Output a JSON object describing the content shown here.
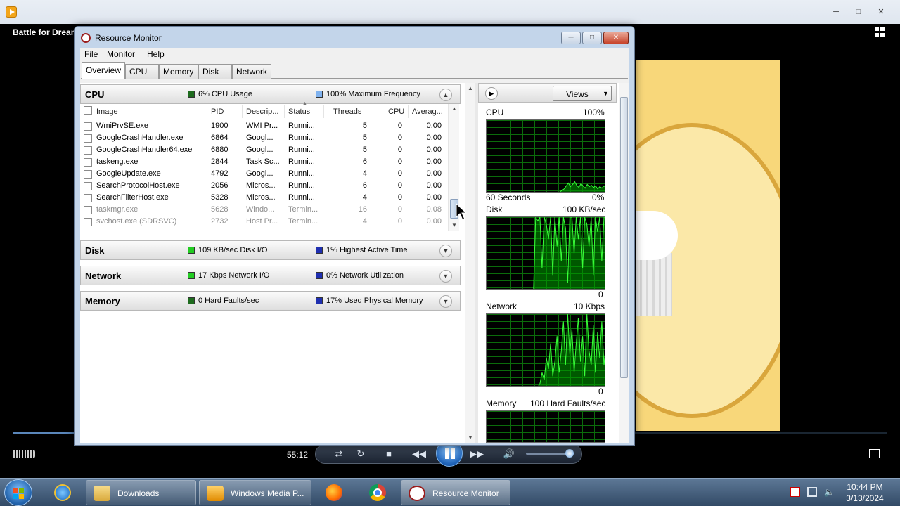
{
  "media_player": {
    "title": "Battle for Dream",
    "time": "55:12",
    "progress_fraction": 0.07,
    "volume_fraction": 0.88,
    "window_controls": [
      "minimize",
      "maximize",
      "close"
    ],
    "icons": [
      "switch-to-library-icon",
      "shuffle-icon",
      "repeat-icon",
      "stop-icon",
      "previous-icon",
      "pause-icon",
      "next-icon",
      "volume-icon",
      "fullscreen-icon",
      "play-speed-gripper-icon"
    ]
  },
  "resource_monitor": {
    "window_title": "Resource Monitor",
    "menu": [
      "File",
      "Monitor",
      "Help"
    ],
    "tabs": [
      "Overview",
      "CPU",
      "Memory",
      "Disk",
      "Network"
    ],
    "active_tab": "Overview",
    "sections": {
      "cpu": {
        "title": "CPU",
        "metric1": "6% CPU Usage",
        "metric1_color": "#1e6b1e",
        "metric2": "100% Maximum Frequency",
        "metric2_color": "#7fb2ef"
      },
      "disk": {
        "title": "Disk",
        "metric1": "109 KB/sec Disk I/O",
        "metric1_color": "#22cc22",
        "metric2": "1% Highest Active Time",
        "metric2_color": "#1f2fb0"
      },
      "network": {
        "title": "Network",
        "metric1": "17 Kbps Network I/O",
        "metric1_color": "#22cc22",
        "metric2": "0% Network Utilization",
        "metric2_color": "#1f2fb0"
      },
      "memory": {
        "title": "Memory",
        "metric1": "0 Hard Faults/sec",
        "metric1_color": "#1e6b1e",
        "metric2": "17% Used Physical Memory",
        "metric2_color": "#1f2fb0"
      }
    },
    "columns": [
      "Image",
      "PID",
      "Descrip...",
      "Status",
      "Threads",
      "CPU",
      "Averag..."
    ],
    "processes": [
      {
        "image": "WmiPrvSE.exe",
        "pid": "1900",
        "desc": "WMI Pr...",
        "status": "Runni...",
        "threads": "5",
        "cpu": "0",
        "avg": "0.00",
        "terminated": false
      },
      {
        "image": "GoogleCrashHandler.exe",
        "pid": "6864",
        "desc": "Googl...",
        "status": "Runni...",
        "threads": "5",
        "cpu": "0",
        "avg": "0.00",
        "terminated": false
      },
      {
        "image": "GoogleCrashHandler64.exe",
        "pid": "6880",
        "desc": "Googl...",
        "status": "Runni...",
        "threads": "5",
        "cpu": "0",
        "avg": "0.00",
        "terminated": false
      },
      {
        "image": "taskeng.exe",
        "pid": "2844",
        "desc": "Task Sc...",
        "status": "Runni...",
        "threads": "6",
        "cpu": "0",
        "avg": "0.00",
        "terminated": false
      },
      {
        "image": "GoogleUpdate.exe",
        "pid": "4792",
        "desc": "Googl...",
        "status": "Runni...",
        "threads": "4",
        "cpu": "0",
        "avg": "0.00",
        "terminated": false
      },
      {
        "image": "SearchProtocolHost.exe",
        "pid": "2056",
        "desc": "Micros...",
        "status": "Runni...",
        "threads": "6",
        "cpu": "0",
        "avg": "0.00",
        "terminated": false
      },
      {
        "image": "SearchFilterHost.exe",
        "pid": "5328",
        "desc": "Micros...",
        "status": "Runni...",
        "threads": "4",
        "cpu": "0",
        "avg": "0.00",
        "terminated": false
      },
      {
        "image": "taskmgr.exe",
        "pid": "5628",
        "desc": "Windo...",
        "status": "Termin...",
        "threads": "16",
        "cpu": "0",
        "avg": "0.08",
        "terminated": true
      },
      {
        "image": "svchost.exe (SDRSVC)",
        "pid": "2732",
        "desc": "Host Pr...",
        "status": "Termin...",
        "threads": "4",
        "cpu": "0",
        "avg": "0.00",
        "terminated": true
      }
    ],
    "views_label": "Views",
    "graphs": [
      {
        "name": "CPU",
        "max": "100%",
        "footer_left": "60 Seconds",
        "footer_right": "0%",
        "samples": [
          0,
          0,
          0,
          0,
          0,
          0,
          0,
          0,
          0,
          0,
          0,
          0,
          0,
          0,
          0,
          0,
          0,
          0,
          0,
          0,
          0,
          0,
          0,
          0,
          0,
          0,
          0,
          0,
          0,
          0,
          0,
          0,
          0,
          0,
          0,
          2,
          4,
          6,
          10,
          14,
          9,
          12,
          16,
          11,
          8,
          13,
          10,
          7,
          12,
          9,
          11,
          8,
          10,
          6,
          9,
          7,
          10,
          8
        ]
      },
      {
        "name": "Disk",
        "max": "100 KB/sec",
        "footer_left": "",
        "footer_right": "0",
        "samples": [
          0,
          0,
          0,
          0,
          0,
          0,
          0,
          0,
          0,
          0,
          0,
          0,
          0,
          0,
          0,
          0,
          0,
          0,
          0,
          0,
          0,
          0,
          0,
          100,
          95,
          100,
          30,
          100,
          90,
          70,
          100,
          20,
          100,
          60,
          100,
          40,
          100,
          85,
          10,
          100,
          100,
          50,
          100,
          70,
          100,
          30,
          100,
          90,
          60,
          100,
          20,
          100,
          80,
          100,
          40,
          100,
          100
        ]
      },
      {
        "name": "Network",
        "max": "10 Kbps",
        "footer_left": "",
        "footer_right": "0",
        "samples": [
          0,
          0,
          0,
          0,
          0,
          0,
          0,
          0,
          0,
          0,
          0,
          0,
          0,
          0,
          0,
          0,
          0,
          0,
          0,
          0,
          0,
          0,
          0,
          0,
          0,
          5,
          20,
          10,
          40,
          25,
          60,
          15,
          35,
          70,
          20,
          50,
          90,
          30,
          100,
          45,
          80,
          20,
          60,
          95,
          35,
          70,
          15,
          100,
          50,
          30,
          85,
          20,
          75,
          40,
          90,
          30,
          60
        ]
      },
      {
        "name": "Memory",
        "max": "100 Hard Faults/sec",
        "footer_left": "",
        "footer_right": "",
        "samples": []
      }
    ]
  },
  "taskbar": {
    "items": [
      {
        "label": "Downloads",
        "icon": "folder-icon"
      },
      {
        "label": "Windows Media P...",
        "icon": "media-player-icon"
      },
      {
        "label": "Resource Monitor",
        "icon": "resource-monitor-icon"
      }
    ],
    "pinned": [
      "internet-explorer-icon",
      "firefox-icon",
      "chrome-icon"
    ],
    "tray_icons": [
      "action-center-icon",
      "network-icon",
      "volume-muted-icon"
    ],
    "time": "10:44 PM",
    "date": "3/13/2024"
  }
}
